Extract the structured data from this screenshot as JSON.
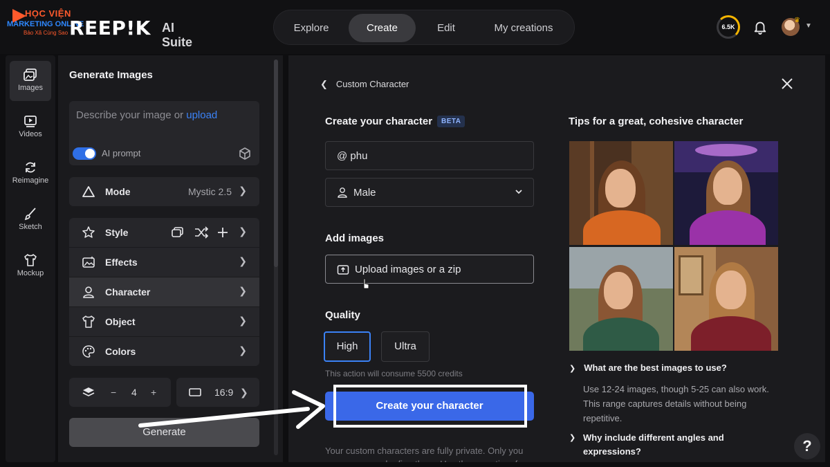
{
  "watermark": {
    "line1": "HỌC VIỆN",
    "line2": "MARKETING ONLINE",
    "line3": "Bảo Xã Cùng Sao"
  },
  "header": {
    "brand": "REEP!K",
    "suite": "AI Suite",
    "credits": "6.5K",
    "nav": [
      {
        "label": "Explore"
      },
      {
        "label": "Create"
      },
      {
        "label": "Edit"
      },
      {
        "label": "My creations"
      }
    ]
  },
  "rail": {
    "items": [
      {
        "label": "Images",
        "icon": "image-icon"
      },
      {
        "label": "Videos",
        "icon": "video-icon"
      },
      {
        "label": "Reimagine",
        "icon": "refresh-icon"
      },
      {
        "label": "Sketch",
        "icon": "brush-icon"
      },
      {
        "label": "Mockup",
        "icon": "shirt-icon"
      }
    ]
  },
  "generate_panel": {
    "title": "Generate Images",
    "prompt_placeholder": "Describe your image or ",
    "prompt_link": "upload",
    "ai_prompt_label": "AI prompt",
    "ai_prompt_on": true,
    "mode_label": "Mode",
    "mode_value": "Mystic 2.5",
    "options": [
      {
        "label": "Style"
      },
      {
        "label": "Effects"
      },
      {
        "label": "Character"
      },
      {
        "label": "Object"
      },
      {
        "label": "Colors"
      }
    ],
    "count_minus": "−",
    "count_value": "4",
    "count_plus": "+",
    "ratio_value": "16:9",
    "generate_label": "Generate"
  },
  "main": {
    "back_label": "Custom Character",
    "create_heading": "Create your character",
    "beta_badge": "BETA",
    "name_value": "@ phu",
    "gender_value": "Male",
    "add_images_heading": "Add images",
    "upload_label": "Upload images or a zip",
    "quality_heading": "Quality",
    "quality_options": [
      "High",
      "Ultra"
    ],
    "quality_selected": "High",
    "consume_text": "This action will consume 5500 credits",
    "create_button": "Create your character",
    "private_note": "Your custom characters are fully private. Only you can access and refine them. Use them anytime for",
    "tips_heading": "Tips for a great, cohesive character",
    "q1": "What are the best images to use?",
    "a1": "Use 12-24 images, though 5-25 can also work. This range captures details without being repetitive.",
    "q2": "Why include different angles and expressions?",
    "help_label": "?"
  },
  "colors": {
    "accent": "#3a68e8",
    "selected_border": "#3b82f6",
    "background": "#0e0e10"
  }
}
